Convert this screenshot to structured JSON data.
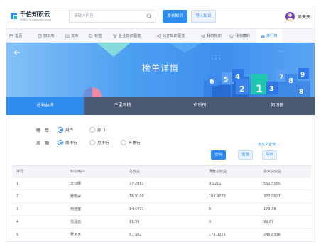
{
  "header": {
    "logo_name": "千伯知识云",
    "logo_sub": "PERFA KnowledgeCloud",
    "search_placeholder": "请输入内容",
    "publish_label": "发布知识",
    "import_label": "导入知识",
    "username": "吴天天"
  },
  "nav": {
    "items": [
      {
        "label": "首页",
        "icon": "home-icon"
      },
      {
        "label": "知识库",
        "icon": "book-icon"
      },
      {
        "label": "文库",
        "icon": "library-icon"
      },
      {
        "label": "标签",
        "icon": "tag-icon"
      },
      {
        "label": "企业知识图谱",
        "icon": "graph-icon"
      },
      {
        "label": "公开知识图谱",
        "icon": "share-icon"
      },
      {
        "label": "我的知识",
        "icon": "send-icon"
      },
      {
        "label": "我收藏的",
        "icon": "heart-icon"
      },
      {
        "label": "排行榜",
        "icon": "bar-chart-icon"
      }
    ]
  },
  "banner": {
    "title": "榜单详情",
    "cube_labels": [
      "6",
      "5",
      "4",
      "2",
      "1",
      "3",
      "7",
      "8",
      "9",
      "8"
    ]
  },
  "tabs": [
    {
      "label": "总收益榜"
    },
    {
      "label": "千里马榜"
    },
    {
      "label": "伯乐榜"
    },
    {
      "label": "知识榜"
    }
  ],
  "filters": {
    "ranking_label": "榜　单",
    "period_label": "周　期",
    "ranking_options": [
      "用户",
      "部门"
    ],
    "period_options": [
      "周排行",
      "月排行",
      "年排行"
    ],
    "custom_label": "自定义查询",
    "query_label": "查询",
    "reset_label": "重置",
    "export_label": "导出"
  },
  "table": {
    "columns": [
      "排行",
      "知识用户",
      "总收益",
      "贡献总收益",
      "投资总收益"
    ],
    "rows": [
      [
        "1",
        "李云娜",
        "37.2981",
        "9.2211",
        "552.5555"
      ],
      [
        "2",
        "黄晓朵",
        "16.9109",
        "102.9783",
        "372.9627"
      ],
      [
        "3",
        "杨洁莹",
        "14.6491",
        "0",
        "173.38"
      ],
      [
        "4",
        "范涵迪",
        "11.99",
        "0",
        "99.87"
      ],
      [
        "5",
        "吴天天",
        "8.7382",
        "175.0271",
        "245.6538"
      ]
    ]
  },
  "colors": {
    "accent": "#2d8cf0",
    "tab_bg": "#4a5a73",
    "avatar": "#6a3fb8"
  }
}
